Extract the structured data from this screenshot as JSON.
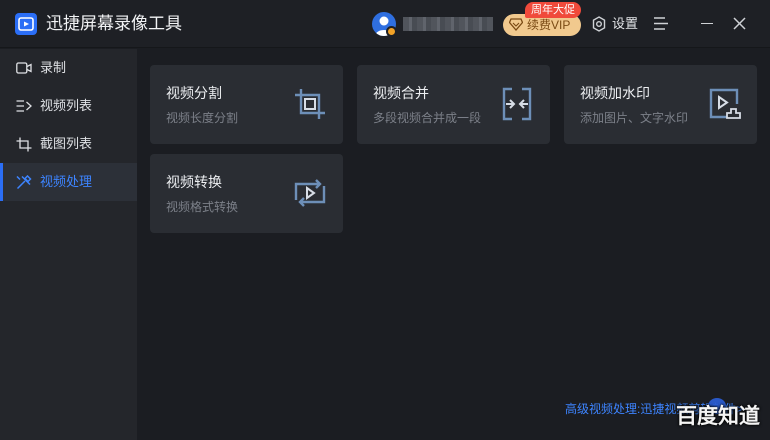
{
  "app": {
    "title": "迅捷屏幕录像工具"
  },
  "header": {
    "promo_tag": "周年大促",
    "vip_label": "续费VIP",
    "settings_label": "设置"
  },
  "sidebar": {
    "items": [
      {
        "label": "录制",
        "icon": "camera-icon"
      },
      {
        "label": "视频列表",
        "icon": "list-icon"
      },
      {
        "label": "截图列表",
        "icon": "screenshot-icon"
      },
      {
        "label": "视频处理",
        "icon": "tools-icon",
        "active": true
      }
    ]
  },
  "tools": [
    {
      "title": "视频分割",
      "desc": "视频长度分割",
      "icon": "crop-icon"
    },
    {
      "title": "视频合并",
      "desc": "多段视频合并成一段",
      "icon": "merge-icon"
    },
    {
      "title": "视频加水印",
      "desc": "添加图片、文字水印",
      "icon": "watermark-icon"
    },
    {
      "title": "视频转换",
      "desc": "视频格式转换",
      "icon": "convert-icon"
    }
  ],
  "footer": {
    "link": "高级视频处理:迅捷视频剪辑软件>"
  },
  "watermark": {
    "text": "百度知道"
  },
  "colors": {
    "accent": "#2b6ef6",
    "vip_bg": "#f1c98e",
    "promo": "#f04a3b"
  }
}
